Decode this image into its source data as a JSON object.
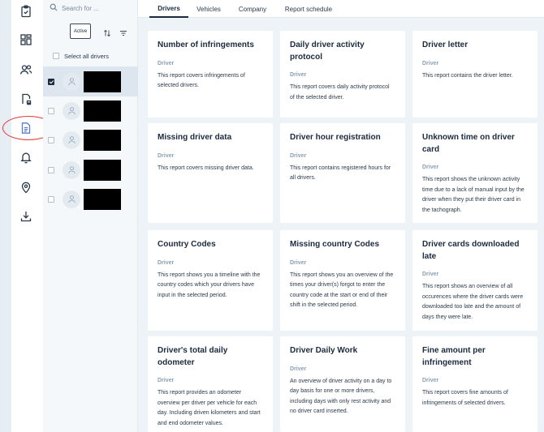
{
  "search": {
    "placeholder": "Search for ..."
  },
  "filters": {
    "active_label": "Active"
  },
  "select_all_label": "Select all drivers",
  "drivers": [
    {
      "selected": true
    },
    {
      "selected": false
    },
    {
      "selected": false
    },
    {
      "selected": false
    },
    {
      "selected": false
    }
  ],
  "tabs": [
    "Drivers",
    "Vehicles",
    "Company",
    "Report schedule"
  ],
  "cards": [
    {
      "title": "Number of infringements",
      "category": "Driver",
      "description": "This report covers infringements of selected drivers."
    },
    {
      "title": "Daily driver activity protocol",
      "category": "Driver",
      "description": "This report covers daily activity protocol of the selected driver."
    },
    {
      "title": "Driver letter",
      "category": "Driver",
      "description": "This report contains the driver letter."
    },
    {
      "title": "Missing driver data",
      "category": "Driver",
      "description": "This report covers missing driver data."
    },
    {
      "title": "Driver hour registration",
      "category": "Driver",
      "description": "This report contains registered hours for all drivers."
    },
    {
      "title": "Unknown time on driver card",
      "category": "Driver",
      "description": "This report shows the unknown activity time due to a lack of manual input by the driver when they put their driver card in the tachograph."
    },
    {
      "title": "Country Codes",
      "category": "Driver",
      "description": "This report shows you a timeline with the country codes which your drivers have input in the selected period."
    },
    {
      "title": "Missing country Codes",
      "category": "Driver",
      "description": "This report shows you an overview of the times your driver(s) forgot to enter the country code at the start or end of their shift in the selected period."
    },
    {
      "title": "Driver cards downloaded late",
      "category": "Driver",
      "description": "This report shows an overview of all occurences where the driver cards were downloaded too late and the amount of days they were late."
    },
    {
      "title": "Driver's total daily odometer",
      "category": "Driver",
      "description": "This report provides an odometer overview per driver per vehicle for each day. Including driven kilometers and start and end odometer values."
    },
    {
      "title": "Driver Daily Work",
      "category": "Driver",
      "description": "An overview of driver activity on a day to day basis for one or more drivers, including days with only rest activity and no driver card inserted."
    },
    {
      "title": "Fine amount per infringement",
      "category": "Driver",
      "description": "This report covers fine amounts of infringements of selected drivers."
    }
  ],
  "rail_icons": [
    "clipboard-check-icon",
    "dashboard-grid-icon",
    "users-icon",
    "vehicle-document-icon",
    "reports-document-icon",
    "bell-icon",
    "location-pin-icon",
    "download-tray-icon"
  ],
  "colors": {
    "highlight": "#e53935",
    "text_dark": "#1b2a3d",
    "category": "#8aa0b2",
    "main_bg": "#eef3f7"
  }
}
